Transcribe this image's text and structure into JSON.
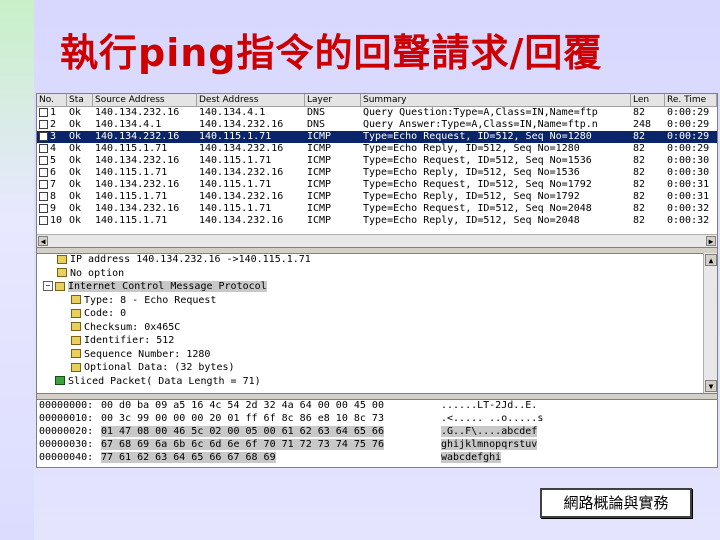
{
  "slide": {
    "title": "執行ping指令的回聲請求/回覆",
    "footer": "網路概論與實務"
  },
  "packet_list": {
    "headers": [
      "No.",
      "Sta",
      "Source Address",
      "Dest Address",
      "Layer",
      "Summary",
      "Len",
      "Re. Time"
    ],
    "rows": [
      {
        "no": "1",
        "st": "Ok",
        "src": "140.134.232.16",
        "dst": "140.134.4.1",
        "proto": "DNS",
        "summary": "Query Question:Type=A,Class=IN,Name=ftp",
        "len": "82",
        "time": "0:00:29"
      },
      {
        "no": "2",
        "st": "Ok",
        "src": "140.134.4.1",
        "dst": "140.134.232.16",
        "proto": "DNS",
        "summary": "Query Answer:Type=A,Class=IN,Name=ftp.n",
        "len": "248",
        "time": "0:00:29"
      },
      {
        "no": "3",
        "st": "Ok",
        "src": "140.134.232.16",
        "dst": "140.115.1.71",
        "proto": "ICMP",
        "summary": "Type=Echo Request, ID=512, Seq No=1280",
        "len": "82",
        "time": "0:00:29",
        "selected": true
      },
      {
        "no": "4",
        "st": "Ok",
        "src": "140.115.1.71",
        "dst": "140.134.232.16",
        "proto": "ICMP",
        "summary": "Type=Echo Reply, ID=512, Seq No=1280",
        "len": "82",
        "time": "0:00:29"
      },
      {
        "no": "5",
        "st": "Ok",
        "src": "140.134.232.16",
        "dst": "140.115.1.71",
        "proto": "ICMP",
        "summary": "Type=Echo Request, ID=512, Seq No=1536",
        "len": "82",
        "time": "0:00:30"
      },
      {
        "no": "6",
        "st": "Ok",
        "src": "140.115.1.71",
        "dst": "140.134.232.16",
        "proto": "ICMP",
        "summary": "Type=Echo Reply, ID=512, Seq No=1536",
        "len": "82",
        "time": "0:00:30"
      },
      {
        "no": "7",
        "st": "Ok",
        "src": "140.134.232.16",
        "dst": "140.115.1.71",
        "proto": "ICMP",
        "summary": "Type=Echo Request, ID=512, Seq No=1792",
        "len": "82",
        "time": "0:00:31"
      },
      {
        "no": "8",
        "st": "Ok",
        "src": "140.115.1.71",
        "dst": "140.134.232.16",
        "proto": "ICMP",
        "summary": "Type=Echo Reply, ID=512, Seq No=1792",
        "len": "82",
        "time": "0:00:31"
      },
      {
        "no": "9",
        "st": "Ok",
        "src": "140.134.232.16",
        "dst": "140.115.1.71",
        "proto": "ICMP",
        "summary": "Type=Echo Request, ID=512, Seq No=2048",
        "len": "82",
        "time": "0:00:32"
      },
      {
        "no": "10",
        "st": "Ok",
        "src": "140.115.1.71",
        "dst": "140.134.232.16",
        "proto": "ICMP",
        "summary": "Type=Echo Reply, ID=512, Seq No=2048",
        "len": "82",
        "time": "0:00:32"
      }
    ]
  },
  "tree": [
    {
      "text": "IP address 140.134.232.16 ->140.115.1.71",
      "icon": "folder"
    },
    {
      "text": "No option",
      "icon": "folder"
    },
    {
      "text": "Internet Control Message Protocol",
      "icon": "folder",
      "expander": "−",
      "highlight": true
    },
    {
      "text": "Type: 8 - Echo Request",
      "icon": "folder",
      "indent": true
    },
    {
      "text": "Code: 0",
      "icon": "folder",
      "indent": true
    },
    {
      "text": "Checksum: 0x465C",
      "icon": "folder",
      "indent": true
    },
    {
      "text": "Identifier: 512",
      "icon": "folder",
      "indent": true
    },
    {
      "text": "Sequence Number: 1280",
      "icon": "folder",
      "indent": true
    },
    {
      "text": "Optional Data: (32 bytes)",
      "icon": "folder",
      "indent": true
    },
    {
      "text": "Sliced Packet( Data Length = 71)",
      "icon": "green"
    }
  ],
  "hex": [
    {
      "off": "00000000:",
      "bytes": "00 d0 ba 09 a5 16 4c 54 2d 32 4a 64 00 00 45 00",
      "ascii": "......LT-2Jd..E."
    },
    {
      "off": "00000010:",
      "bytes": "00 3c 99 00 00 00 20 01 ff 6f 8c 86 e8 10 8c 73",
      "ascii": ".<..... ..o.....s"
    },
    {
      "off": "00000020:",
      "bytes": "01 47 08 00 46 5c 02 00 05 00 61 62 63 64 65 66",
      "ascii": ".G..F\\....abcdef"
    },
    {
      "off": "00000030:",
      "bytes": "67 68 69 6a 6b 6c 6d 6e 6f 70 71 72 73 74 75 76",
      "ascii": "ghijklmnopqrstuv"
    },
    {
      "off": "00000040:",
      "bytes": "77 61 62 63 64 65 66 67 68 69",
      "ascii": "wabcdefghi"
    }
  ]
}
